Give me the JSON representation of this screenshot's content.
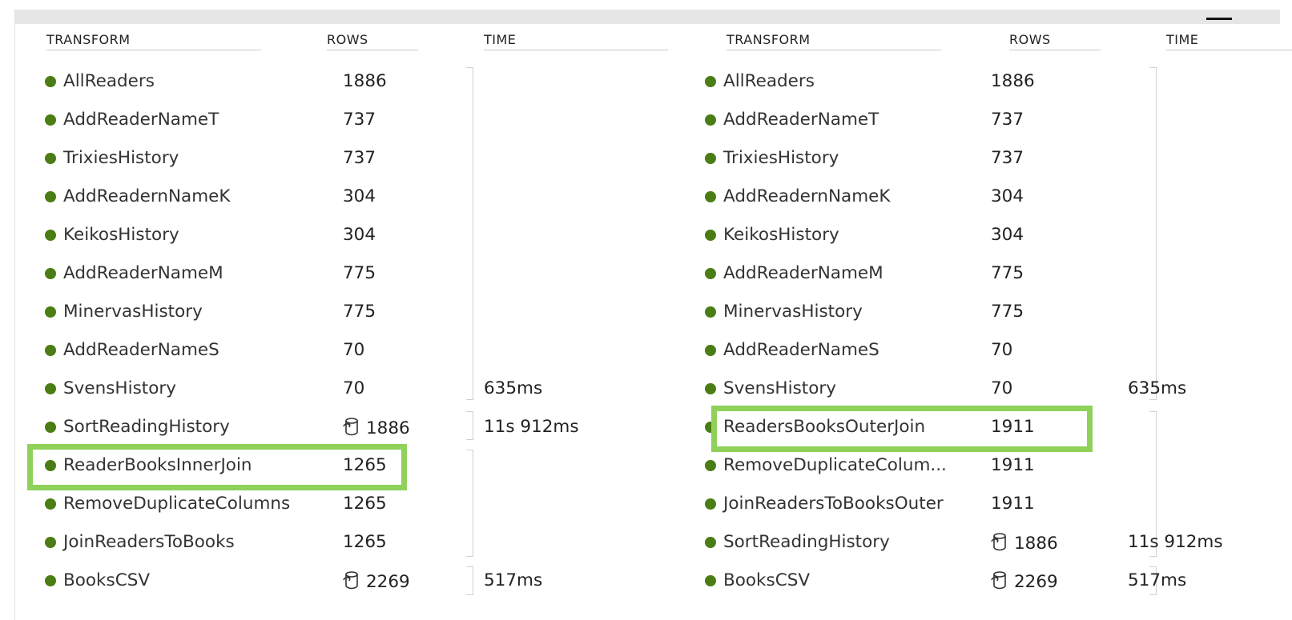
{
  "colors": {
    "status_dot": "#4a7d14",
    "highlight": "#8fd15a"
  },
  "left": {
    "headers": {
      "transform": "TRANSFORM",
      "rows": "ROWS",
      "time": "TIME"
    },
    "rows": [
      {
        "name": "AllReaders",
        "rows": "1886",
        "time": ""
      },
      {
        "name": "AddReaderNameT",
        "rows": "737",
        "time": ""
      },
      {
        "name": "TrixiesHistory",
        "rows": "737",
        "time": ""
      },
      {
        "name": "AddReadernNameK",
        "rows": "304",
        "time": ""
      },
      {
        "name": "KeikosHistory",
        "rows": "304",
        "time": ""
      },
      {
        "name": "AddReaderNameM",
        "rows": "775",
        "time": ""
      },
      {
        "name": "MinervasHistory",
        "rows": "775",
        "time": ""
      },
      {
        "name": "AddReaderNameS",
        "rows": "70",
        "time": ""
      },
      {
        "name": "SvensHistory",
        "rows": "70",
        "time": "635ms"
      },
      {
        "name": "SortReadingHistory",
        "rows": "1886",
        "time": "11s 912ms",
        "cached": true,
        "icon": "cache-icon"
      },
      {
        "name": "ReaderBooksInnerJoin",
        "rows": "1265",
        "time": "",
        "highlighted": true
      },
      {
        "name": "RemoveDuplicateColumns",
        "rows": "1265",
        "time": ""
      },
      {
        "name": "JoinReadersToBooks",
        "rows": "1265",
        "time": ""
      },
      {
        "name": "BooksCSV",
        "rows": "2269",
        "time": "517ms",
        "cached": true,
        "icon": "cache-icon"
      }
    ]
  },
  "right": {
    "headers": {
      "transform": "TRANSFORM",
      "rows": "ROWS",
      "time": "TIME"
    },
    "rows": [
      {
        "name": "AllReaders",
        "rows": "1886",
        "time": ""
      },
      {
        "name": "AddReaderNameT",
        "rows": "737",
        "time": ""
      },
      {
        "name": "TrixiesHistory",
        "rows": "737",
        "time": ""
      },
      {
        "name": "AddReadernNameK",
        "rows": "304",
        "time": ""
      },
      {
        "name": "KeikosHistory",
        "rows": "304",
        "time": ""
      },
      {
        "name": "AddReaderNameM",
        "rows": "775",
        "time": ""
      },
      {
        "name": "MinervasHistory",
        "rows": "775",
        "time": ""
      },
      {
        "name": "AddReaderNameS",
        "rows": "70",
        "time": ""
      },
      {
        "name": "SvensHistory",
        "rows": "70",
        "time": "635ms"
      },
      {
        "name": "ReadersBooksOuterJoin",
        "rows": "1911",
        "time": "",
        "highlighted": true
      },
      {
        "name": "RemoveDuplicateColum...",
        "rows": "1911",
        "time": ""
      },
      {
        "name": "JoinReadersToBooksOuter",
        "rows": "1911",
        "time": ""
      },
      {
        "name": "SortReadingHistory",
        "rows": "1886",
        "time": "11s 912ms",
        "cached": true,
        "icon": "cache-icon"
      },
      {
        "name": "BooksCSV",
        "rows": "2269",
        "time": "517ms",
        "cached": true,
        "icon": "cache-icon"
      }
    ]
  }
}
